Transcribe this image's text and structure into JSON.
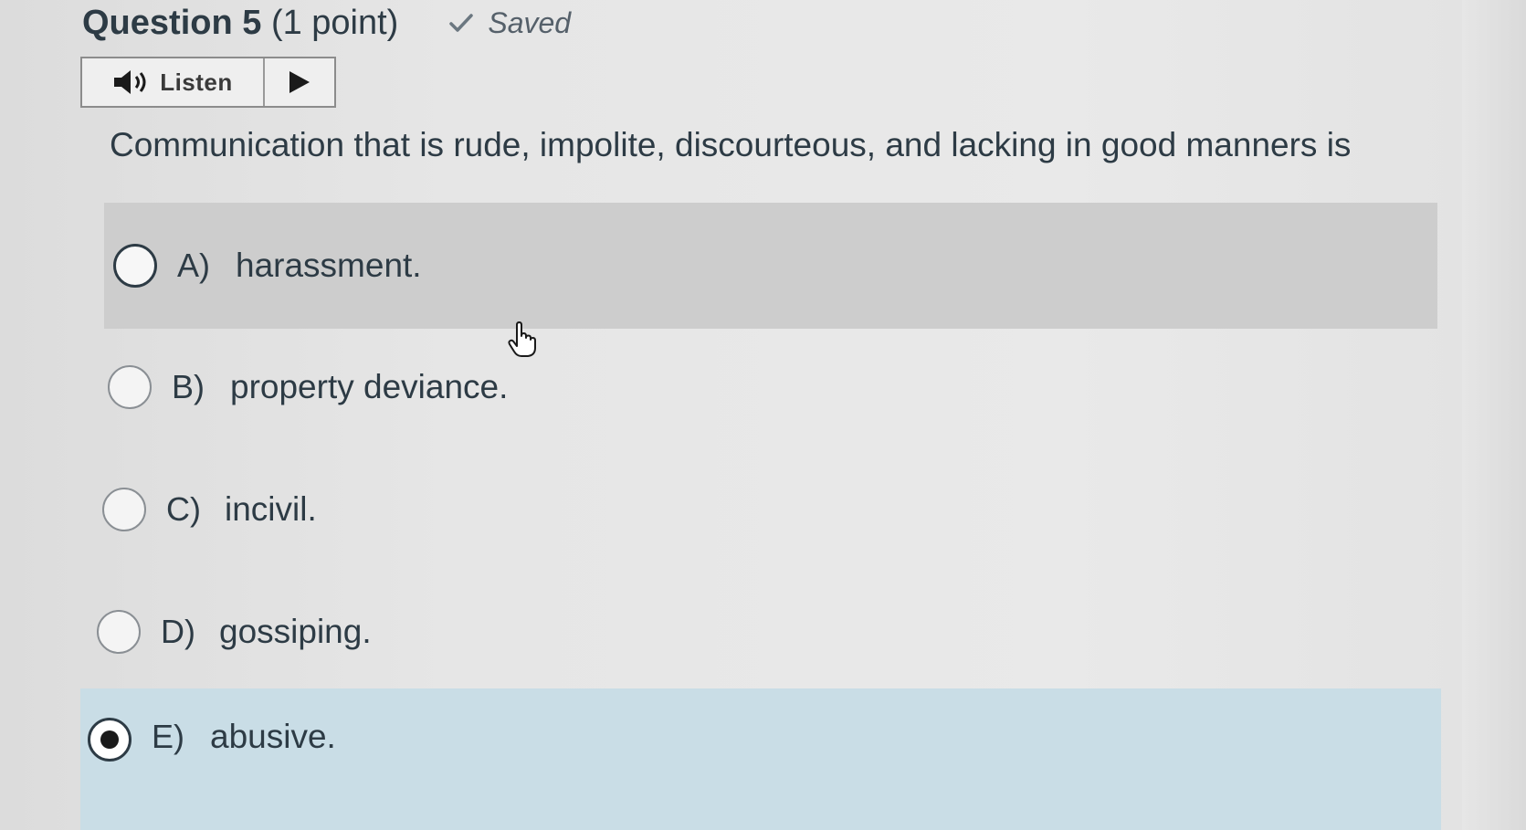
{
  "question": {
    "number_label": "Question 5",
    "points_label": "(1 point)",
    "status_label": "Saved",
    "status_icon": "checkmark-icon",
    "text": "Communication that is rude, impolite, discourteous, and lacking in good manners is"
  },
  "listen": {
    "label": "Listen",
    "speaker_icon": "speaker-icon",
    "play_icon": "play-icon"
  },
  "options": [
    {
      "letter": "A)",
      "text": "harassment.",
      "selected": false,
      "hovered": true
    },
    {
      "letter": "B)",
      "text": "property deviance.",
      "selected": false,
      "hovered": false
    },
    {
      "letter": "C)",
      "text": "incivil.",
      "selected": false,
      "hovered": false
    },
    {
      "letter": "D)",
      "text": "gossiping.",
      "selected": false,
      "hovered": false
    },
    {
      "letter": "E)",
      "text": "abusive.",
      "selected": true,
      "hovered": false
    }
  ],
  "colors": {
    "text": "#2d3b45",
    "hover_bg": "#cdcdcd",
    "selected_bg": "#c9dde6"
  }
}
